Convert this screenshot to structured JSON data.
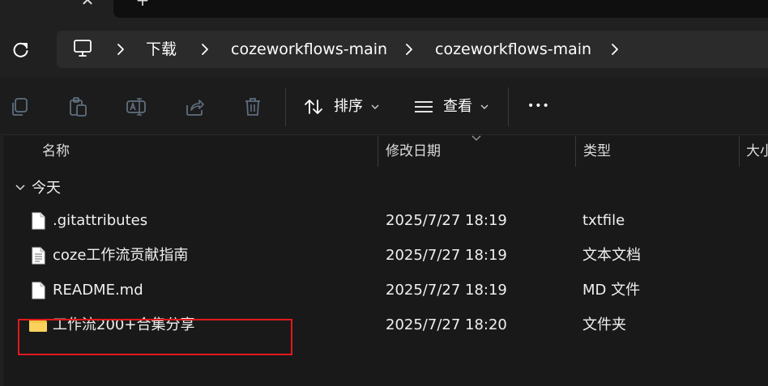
{
  "window": {
    "tab_close": "✕",
    "tab_new": "+"
  },
  "breadcrumb": [
    {
      "label": "下载"
    },
    {
      "label": "cozeworkflows-main"
    },
    {
      "label": "cozeworkflows-main"
    }
  ],
  "toolbar": {
    "sort_label": "排序",
    "view_label": "查看",
    "more_label": "•••"
  },
  "columns": {
    "name": "名称",
    "modified": "修改日期",
    "type": "类型",
    "size": "大小"
  },
  "group": {
    "label": "今天",
    "chevron": "∨"
  },
  "files": [
    {
      "name": ".gitattributes",
      "modified": "2025/7/27 18:19",
      "type": "txtfile",
      "icon": "file-icon"
    },
    {
      "name": "coze工作流贡献指南",
      "modified": "2025/7/27 18:19",
      "type": "文本文档",
      "icon": "text-file-icon"
    },
    {
      "name": "README.md",
      "modified": "2025/7/27 18:19",
      "type": "MD 文件",
      "icon": "file-icon"
    },
    {
      "name": "工作流200+合集分享",
      "modified": "2025/7/27 18:20",
      "type": "文件夹",
      "icon": "folder-icon"
    }
  ],
  "colors": {
    "background": "#191919",
    "toolbar": "#1c1c1c",
    "address_bar": "#2b2b2b",
    "highlight": "#e0191e",
    "folder": "#f5c542"
  }
}
